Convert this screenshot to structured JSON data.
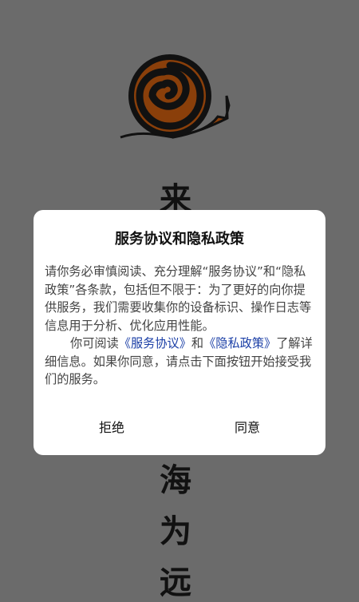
{
  "splash": {
    "chars": [
      "来",
      "海",
      "为",
      "远"
    ],
    "logo_colors": {
      "shell": "#8a3f0a",
      "outline": "#111111",
      "body": "#8a3f0a"
    }
  },
  "dialog": {
    "title": "服务协议和隐私政策",
    "paragraph1": "请你务必审慎阅读、充分理解“服务协议”和“隐私政策”各条款，包括但不限于：为了更好的向你提供服务，我们需要收集你的设备标识、操作日志等信息用于分析、优化应用性能。",
    "p2_prefix": "你可阅读",
    "service_link": "《服务协议》",
    "p2_and": "和",
    "privacy_link": "《隐私政策》",
    "p2_suffix": "了解详细信息。如果你同意，请点击下面按钮开始接受我们的服务。",
    "reject_label": "拒绝",
    "agree_label": "同意",
    "link_color": "#1a3ea6"
  }
}
